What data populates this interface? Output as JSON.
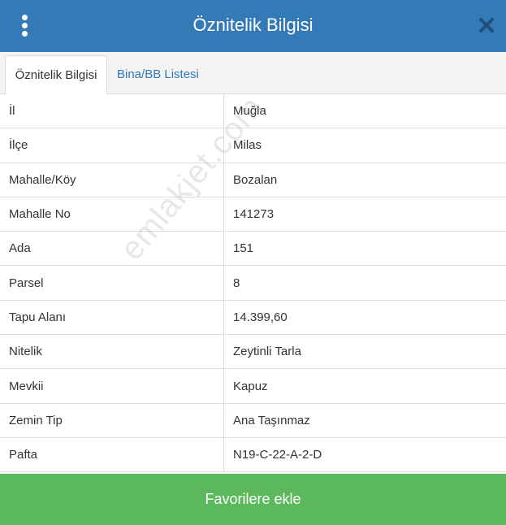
{
  "header": {
    "title": "Öznitelik Bilgisi"
  },
  "tabs": [
    {
      "label": "Öznitelik Bilgisi",
      "active": true
    },
    {
      "label": "Bina/BB Listesi",
      "active": false
    }
  ],
  "attributes": [
    {
      "key": "İl",
      "value": "Muğla"
    },
    {
      "key": "İlçe",
      "value": "Milas"
    },
    {
      "key": "Mahalle/Köy",
      "value": "Bozalan"
    },
    {
      "key": "Mahalle No",
      "value": "141273"
    },
    {
      "key": "Ada",
      "value": "151"
    },
    {
      "key": "Parsel",
      "value": "8"
    },
    {
      "key": "Tapu Alanı",
      "value": "14.399,60"
    },
    {
      "key": "Nitelik",
      "value": "Zeytinli Tarla"
    },
    {
      "key": "Mevkii",
      "value": "Kapuz"
    },
    {
      "key": "Zemin Tip",
      "value": "Ana Taşınmaz"
    },
    {
      "key": "Pafta",
      "value": "N19-C-22-A-2-D"
    }
  ],
  "watermark": "emlakjet.com",
  "footer": {
    "favorite_label": "Favorilere ekle"
  },
  "colors": {
    "header": "#337ab7",
    "favorite_button": "#5cb85c"
  },
  "icons": {
    "menu": "vertical-ellipsis-icon",
    "close": "close-icon"
  }
}
